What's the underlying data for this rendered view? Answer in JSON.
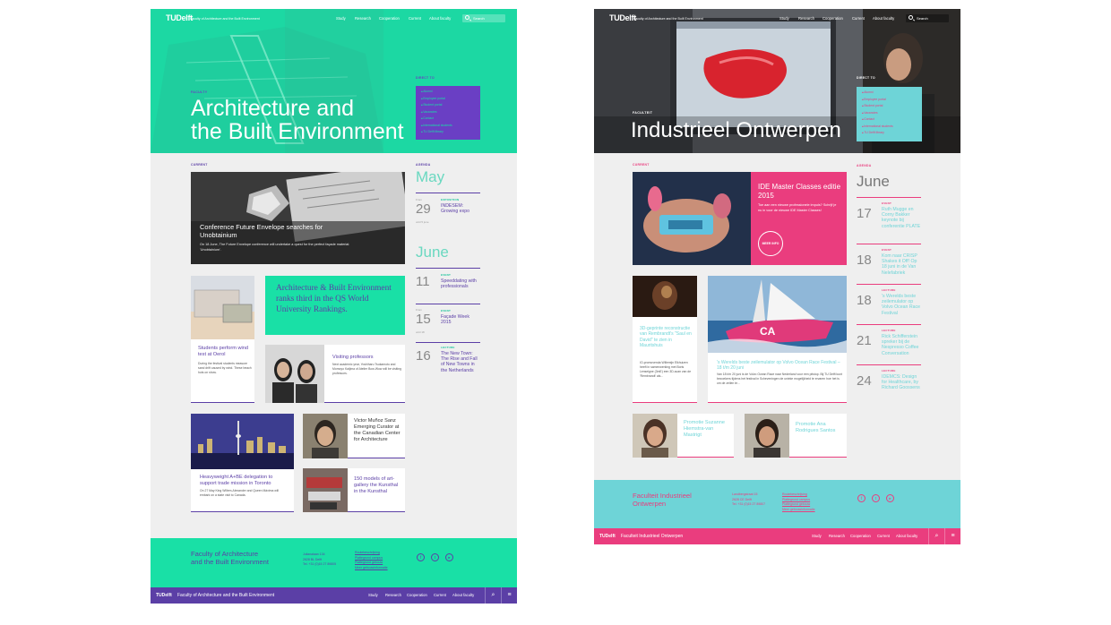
{
  "left_page": {
    "nav": {
      "logo": "TUDelft",
      "faculty": "Faculty of Architecture and the Built Environment",
      "menu": [
        "Study",
        "Research",
        "Cooperation",
        "Current",
        "About faculty"
      ],
      "search_placeholder": "Search"
    },
    "hero": {
      "kicker": "FACULTY",
      "title_line1": "Architecture and",
      "title_line2": "the Built Environment",
      "direct_to": "DIRECT TO",
      "direct_links": [
        "Alumni",
        "Employee portal",
        "Student portal",
        "Vacancies",
        "Contact",
        "International students",
        "TU Delft library"
      ]
    },
    "current_label": "CURRENT",
    "agenda_label": "AGENDA",
    "feature": {
      "title": "Conference Future Envelope searches for Unobtainium",
      "text": "On 18 June, The Future Envelope conference will undertake a quest for the perfect façade material: 'Unobtainium'."
    },
    "ranking": "Architecture & Built Environment ranks third in the QS World University Rankings.",
    "wind": {
      "title": "Students perform wind test at Oerol",
      "text": "During the festival students measure sand drift caused by wind. These beach huts on show."
    },
    "visiting": {
      "title": "Visiting professors",
      "text": "Next academic year, Yoshiharu Tsukamoto and Momoyo Kaijima of Atelier Bow-Wow will be visiting professors."
    },
    "toronto": {
      "title": "Heavyweight A+BE delegation to support trade mission in Toronto",
      "text": "On 27 May King Willem-Alexander and Queen Máxima will embark on a state visit to Canada."
    },
    "curator": {
      "title": "Victor Muñoz Sanz Emerging Curator at the Canadian Center for Architecture"
    },
    "models": {
      "title": "150 models of art-gallery the Kunsthal in the Kunsthal"
    },
    "agenda": {
      "may": "May",
      "may_events": [
        {
          "pre": "From",
          "day": "29",
          "post": "until 5 june",
          "label": "EXPOSITION",
          "title": "INDESEM: Growing expo"
        }
      ],
      "june": "June",
      "june_events": [
        {
          "pre": "",
          "day": "11",
          "post": "",
          "label": "EVENT",
          "title": "Speeddating with professionals"
        },
        {
          "pre": "From",
          "day": "15",
          "post": "until 18",
          "label": "EVENT",
          "title": "Façade Week 2015"
        },
        {
          "pre": "",
          "day": "16",
          "post": "",
          "label": "LECTURE",
          "title": "The New Town: The Rise and Fall of New Towns in the Netherlands"
        }
      ]
    },
    "footer": {
      "title_line1": "Faculty of Architecture",
      "title_line2": "and the Built Environment",
      "address": [
        "Julianalaan 134",
        "2628 BL Delft",
        "Tel. +31 (0)15 27 89805"
      ],
      "links": [
        "Routebeschrijving",
        "Plattegrond campus",
        "Plattegrond gebouw",
        "Meer gebouwinformatie"
      ],
      "bar_logo": "TUDelft",
      "bar_name": "Faculty of Architecture and the Built Environment",
      "bar_menu": [
        "Study",
        "Research",
        "Cooperation",
        "Current",
        "About faculty"
      ]
    }
  },
  "right_page": {
    "nav": {
      "logo": "TUDelft",
      "faculty": "Faculty of Architecture and the Built Environment",
      "menu": [
        "Study",
        "Research",
        "Cooperation",
        "Current",
        "About faculty"
      ],
      "search_placeholder": "Search"
    },
    "hero": {
      "kicker": "FACULTEIT",
      "title": "Industrieel Ontwerpen",
      "direct_to": "DIRECT TO",
      "direct_links": [
        "Alumni",
        "Employee portal",
        "Student portal",
        "Vacancies",
        "Contact",
        "International students",
        "TU Delft library"
      ]
    },
    "current_label": "CURRENT",
    "agenda_label": "AGENDA",
    "feature": {
      "title": "IDE Master Classes editie 2015",
      "text": "Toe aan een nieuwe professionele impuls? Schrijf je nu in voor de nieuwe IDE Master Classes!",
      "button": "MEER INFO"
    },
    "rembrandt": {
      "title": "3D-geprinte reconstructie van Rembrandt's \"Saul en David\" te zien in Mauritshuis",
      "text": "IO-promovenda Willemijn Elkhuizen heeft in samenwerking met Boris Lenseigne (3mE) een 3D-scan van de 'Rembrandt' als..."
    },
    "volvo": {
      "title": "'s Werelds beste zeilemulator op Volvo Ocean Race Festival – 18 t/m 20 juni",
      "text": "Van 18 t/m 20 juni is de Volvo Ocean Race naar Nederland voor een pitstop. Bij TU Delft kunt bezoekers tijdens het festival in Scheveningen de unieke mogelijkheid te ervaren hoe het is om de zeilen te..."
    },
    "promo1": "Promotie Suzanne Hiemstra-van Mastrigt",
    "promo2": "Promotie Ana Rodrigues Santos",
    "agenda": {
      "june": "June",
      "events": [
        {
          "day": "17",
          "label": "EVENT",
          "title": "Ruth Mugge en Corny Bakker keynote bij conferentie PLATE"
        },
        {
          "day": "18",
          "label": "EVENT",
          "title": "Kom naar CRISP Shakes it Off! Op 18 juni in de Van Nelefabriek"
        },
        {
          "day": "18",
          "label": "LECTURE",
          "title": "'s Werelds beste zeilemulator op Volvo Ocean Race Festival"
        },
        {
          "day": "21",
          "label": "LECTURE",
          "title": "Rick Schifferstein spreker bij de Nespresso Coffee Conversation"
        },
        {
          "day": "24",
          "label": "LECTURE",
          "title": "IDEMCS: Design for Healthcare, by Richard Goossens"
        }
      ]
    },
    "footer": {
      "title_line1": "Faculteit Industrieel",
      "title_line2": "Ontwerpen",
      "address": [
        "Landbergstraat 15",
        "2628 CE Delft",
        "Tel. +31 (0)15 27 89807"
      ],
      "links": [
        "Routebeschrijving",
        "Plattegrond campus",
        "Plattegrond gebouw",
        "Meer gebouwinformatie"
      ],
      "bar_logo": "TUDelft",
      "bar_name": "Faculteit Industrieel Ontwerpen",
      "bar_menu": [
        "Study",
        "Research",
        "Cooperation",
        "Current",
        "About faculty"
      ]
    }
  },
  "colors": {
    "green": "#19e0a6",
    "purple": "#5b3fa6",
    "pink": "#ea3d7e",
    "cyan": "#6ed4d7",
    "bg": "#efefef"
  }
}
